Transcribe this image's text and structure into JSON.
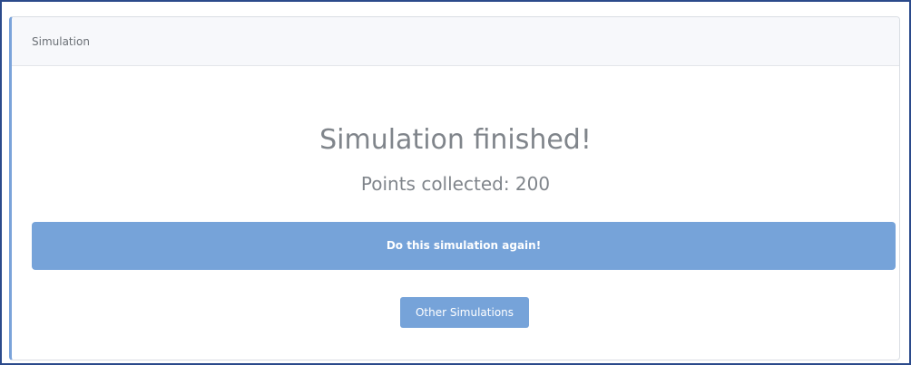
{
  "card": {
    "header_title": "Simulation"
  },
  "result": {
    "title": "Simulation finished!",
    "points_text": "Points collected: 200"
  },
  "actions": {
    "again_label": "Do this simulation again!",
    "other_label": "Other Simulations"
  },
  "colors": {
    "button": "#76a3d9",
    "frame_border": "#2b4a8b",
    "accent_border": "#7aa3da"
  }
}
